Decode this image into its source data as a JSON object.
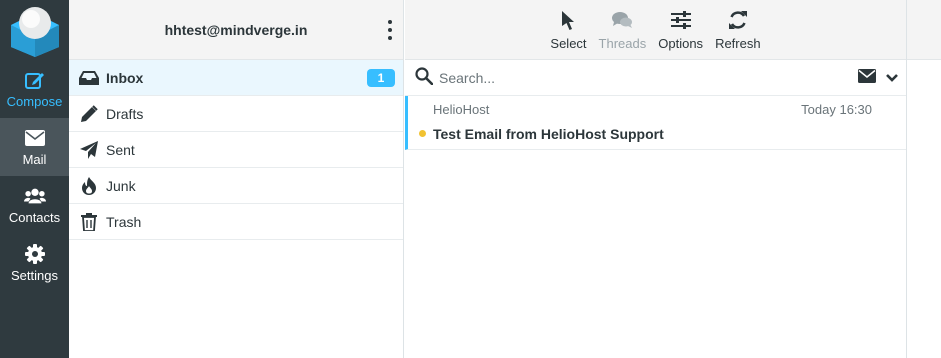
{
  "app": {
    "logo_icon": "roundcube-logo-icon"
  },
  "nav": [
    {
      "label": "Compose",
      "icon": "compose-icon"
    },
    {
      "label": "Mail",
      "icon": "mail-icon"
    },
    {
      "label": "Contacts",
      "icon": "contacts-icon"
    },
    {
      "label": "Settings",
      "icon": "gear-icon"
    }
  ],
  "account": {
    "email": "hhtest@mindverge.in"
  },
  "folders": [
    {
      "label": "Inbox",
      "icon": "inbox-icon",
      "unread": "1"
    },
    {
      "label": "Drafts",
      "icon": "pencil-icon"
    },
    {
      "label": "Sent",
      "icon": "paper-plane-icon"
    },
    {
      "label": "Junk",
      "icon": "fire-icon"
    },
    {
      "label": "Trash",
      "icon": "trash-icon"
    }
  ],
  "toolbar": {
    "select": "Select",
    "threads": "Threads",
    "options": "Options",
    "refresh": "Refresh"
  },
  "search": {
    "placeholder": "Search..."
  },
  "messages": [
    {
      "from": "HelioHost",
      "date": "Today 16:30",
      "subject": "Test Email from HelioHost Support",
      "unread": true
    }
  ],
  "colors": {
    "accent": "#37beff",
    "sidebar": "#2f3a3f",
    "unread_dot": "#f1c232"
  }
}
